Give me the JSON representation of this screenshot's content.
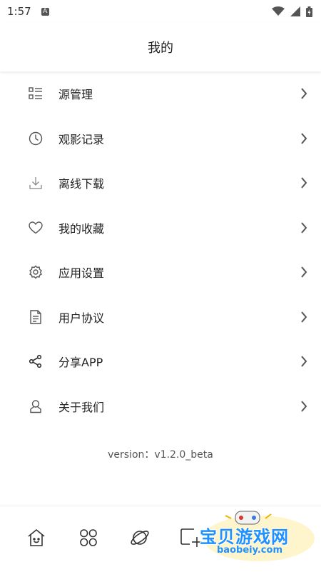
{
  "status_bar": {
    "time": "1:57",
    "notification_badge": "A"
  },
  "header": {
    "title": "我的"
  },
  "menu": {
    "items": [
      {
        "label": "源管理",
        "icon": "list-icon"
      },
      {
        "label": "观影记录",
        "icon": "clock-icon"
      },
      {
        "label": "离线下载",
        "icon": "download-icon"
      },
      {
        "label": "我的收藏",
        "icon": "heart-icon"
      },
      {
        "label": "应用设置",
        "icon": "gear-icon"
      },
      {
        "label": "用户协议",
        "icon": "document-icon"
      },
      {
        "label": "分享APP",
        "icon": "share-icon"
      },
      {
        "label": "关于我们",
        "icon": "user-icon"
      }
    ]
  },
  "version": "version：v1.2.0_beta",
  "tabbar": {
    "tabs": [
      {
        "icon": "home-icon"
      },
      {
        "icon": "grid-icon"
      },
      {
        "icon": "planet-icon"
      },
      {
        "icon": "add-window-icon"
      }
    ]
  },
  "watermark": {
    "title": "宝贝游戏网",
    "url": "baobeiy.com"
  },
  "colors": {
    "text": "#222222",
    "icon": "#555555",
    "watermark": "#1e90ff"
  }
}
